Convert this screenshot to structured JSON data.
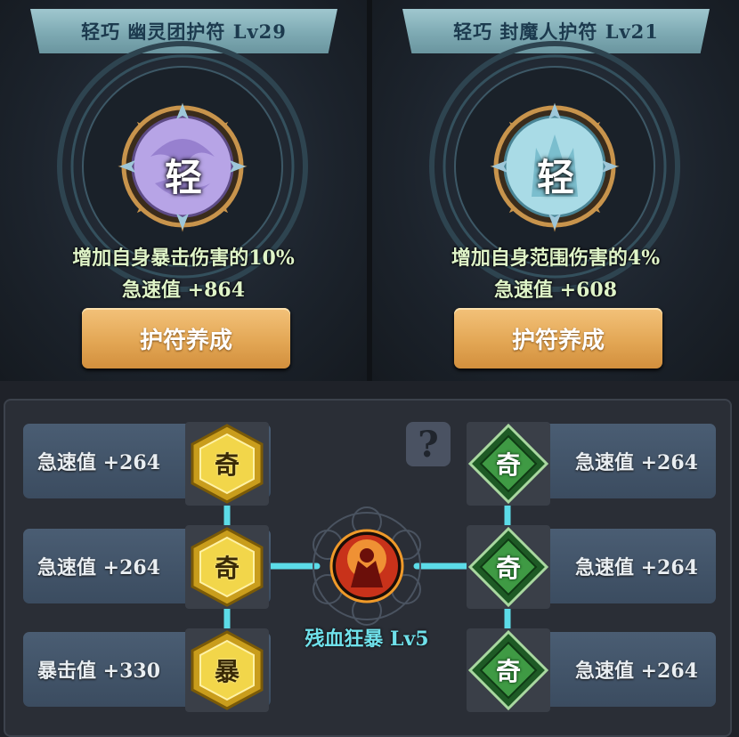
{
  "amulets": [
    {
      "title": "轻巧 幽灵团护符 Lv29",
      "rune": "轻",
      "effect": "增加自身暴击伤害的10%",
      "stat": "急速值 +864",
      "button": "护符养成",
      "orb_color": "#b7a4e6"
    },
    {
      "title": "轻巧 封魔人护符 Lv21",
      "rune": "轻",
      "effect": "增加自身范围伤害的4%",
      "stat": "急速值 +608",
      "button": "护符养成",
      "orb_color": "#a9dbe6"
    }
  ],
  "tree": {
    "help": "?",
    "core_label": "残血狂暴 Lv5",
    "left": [
      {
        "stat": "急速值 +264",
        "gem": "奇",
        "gem_type": "gold",
        "gem_icon": "gold-hexagon-gem-icon"
      },
      {
        "stat": "急速值 +264",
        "gem": "奇",
        "gem_type": "gold",
        "gem_icon": "gold-hexagon-gem-icon"
      },
      {
        "stat": "暴击值 +330",
        "gem": "暴",
        "gem_type": "gold",
        "gem_icon": "gold-hexagon-gem-icon"
      }
    ],
    "right": [
      {
        "stat": "急速值 +264",
        "gem": "奇",
        "gem_type": "green",
        "gem_icon": "green-diamond-gem-icon"
      },
      {
        "stat": "急速值 +264",
        "gem": "奇",
        "gem_type": "green",
        "gem_icon": "green-diamond-gem-icon"
      },
      {
        "stat": "急速值 +264",
        "gem": "奇",
        "gem_type": "green",
        "gem_icon": "green-diamond-gem-icon"
      }
    ]
  },
  "colors": {
    "connector": "#5fe6f2",
    "gold_gem": "#f2d64a",
    "green_gem": "#3f9a44",
    "stat_text_teal": "#6fe0ea",
    "button": "#e3a755"
  }
}
